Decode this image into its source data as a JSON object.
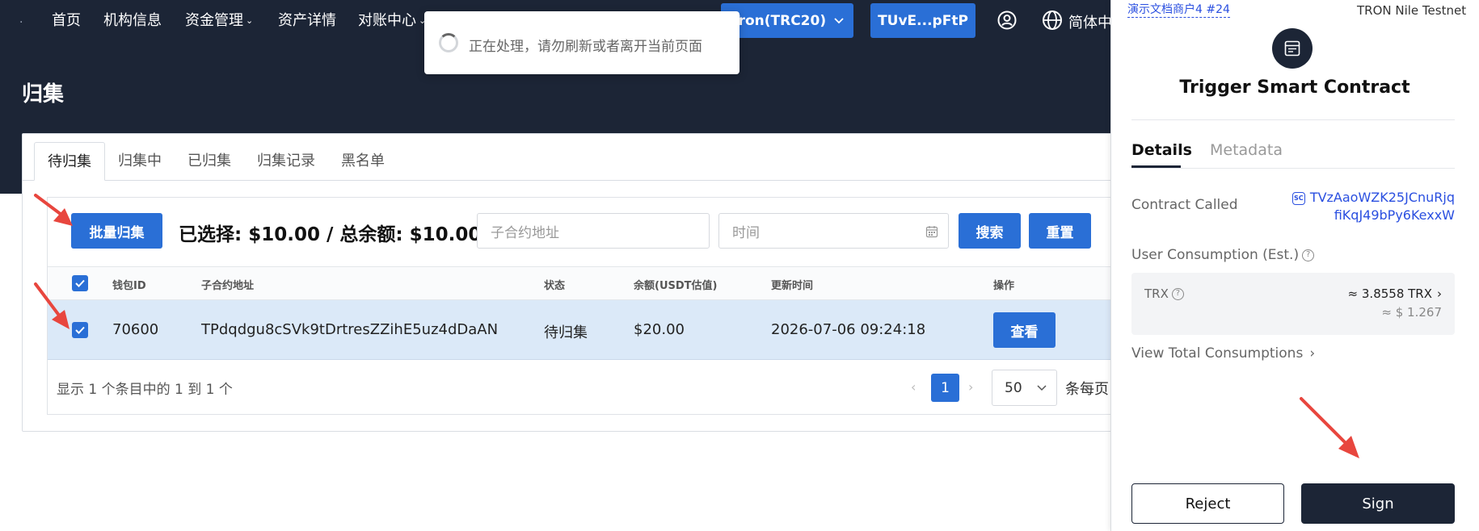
{
  "nav": {
    "items": [
      {
        "label": "首页"
      },
      {
        "label": "机构信息"
      },
      {
        "label": "资金管理"
      },
      {
        "label": "资产详情"
      },
      {
        "label": "对账中心"
      }
    ],
    "network": "Tron(TRC20)",
    "account": "TUvE...pFtP",
    "language": "简体中"
  },
  "page": {
    "title": "归集"
  },
  "tabs": [
    {
      "label": "待归集",
      "active": true
    },
    {
      "label": "归集中"
    },
    {
      "label": "已归集"
    },
    {
      "label": "归集记录"
    },
    {
      "label": "黑名单"
    }
  ],
  "toolbar": {
    "batch_label": "批量归集",
    "summary": "已选择: $10.00 / 总余额: $10.00",
    "address_placeholder": "子合约地址",
    "time_placeholder": "时间",
    "search_label": "搜索",
    "reset_label": "重置"
  },
  "table": {
    "columns": [
      "钱包ID",
      "子合约地址",
      "状态",
      "余额(USDT估值)",
      "更新时间",
      "操作"
    ],
    "rows": [
      {
        "wallet_id": "70600",
        "address": "TPdqdgu8cSVk9tDrtresZZihE5uz4dDaAN",
        "status": "待归集",
        "balance": "$20.00",
        "updated": "2026-07-06 09:24:18",
        "action": "查看",
        "checked": true
      }
    ]
  },
  "pagination": {
    "info": "显示 1 个条目中的 1 到 1 个",
    "current": "1",
    "page_size": "50",
    "per_page_label": "条每页"
  },
  "toast": {
    "text": "正在处理，请勿刷新或者离开当前页面"
  },
  "wallet": {
    "merchant": "演示文档商户4 #24",
    "network": "TRON Nile Testnet",
    "title": "Trigger Smart Contract",
    "tabs": [
      {
        "label": "Details",
        "active": true
      },
      {
        "label": "Metadata"
      }
    ],
    "contract_label": "Contract Called",
    "contract_badge": "SC",
    "contract_line1": "TVzAaoWZK25JCnuRjq",
    "contract_line2": "fiKqJ49bPy6KexxW",
    "consumption_label": "User Consumption (Est.)",
    "trx_label": "TRX",
    "trx_value": "≈ 3.8558 TRX",
    "usd_value": "≈ $ 1.267",
    "view_total": "View Total Consumptions",
    "reject_label": "Reject",
    "sign_label": "Sign"
  },
  "colors": {
    "navy": "#1c2536",
    "primary": "#2a6fd6",
    "link": "#2a4fe0",
    "row_highlight": "#dbe9f8",
    "arrow": "#e8463e"
  }
}
